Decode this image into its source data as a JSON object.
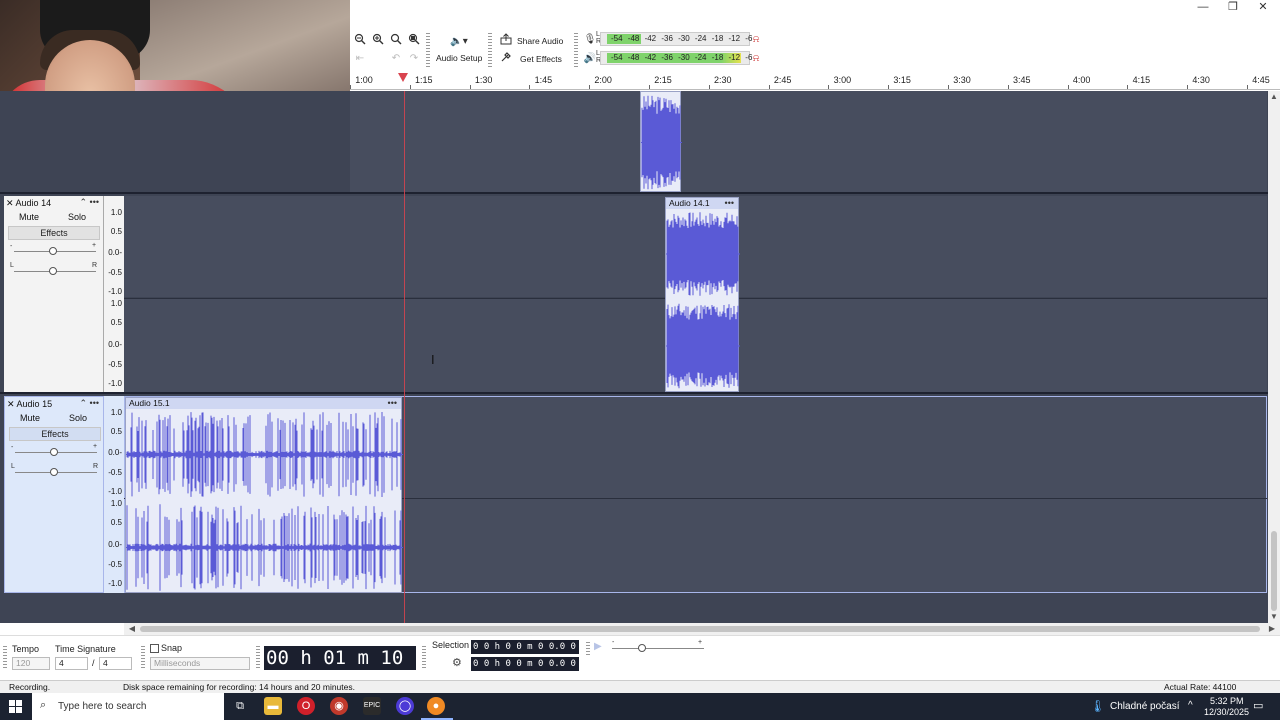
{
  "window": {
    "minimize_glyph": "—",
    "maximize_glyph": "❐",
    "close_glyph": "✕"
  },
  "toolbar": {
    "audio_setup_label": "Audio Setup",
    "share_audio_label": "Share Audio",
    "get_effects_label": "Get Effects",
    "meter_ticks": "-54 -48 -42 -36 -30 -24 -18 -12 -6",
    "meter_record_channels": "L R",
    "meter_play_channels": "L R",
    "icons": [
      "zoom-in-icon",
      "zoom-out-icon",
      "fit-selection-icon",
      "fit-project-icon",
      "zoom-toggle-icon",
      "trim-icon",
      "silence-icon",
      "undo-icon",
      "redo-icon",
      "speaker-icon",
      "microphone-icon",
      "share-icon",
      "effects-icon"
    ]
  },
  "ruler": {
    "labels": [
      "1:00",
      "1:15",
      "1:30",
      "1:45",
      "2:00",
      "2:15",
      "2:30",
      "2:45",
      "3:00",
      "3:15",
      "3:30",
      "3:45",
      "4:00",
      "4:15",
      "4:30",
      "4:45"
    ]
  },
  "tracks": [
    {
      "name": "Audio 14",
      "mute": "Mute",
      "solo": "Solo",
      "effects": "Effects",
      "gain_min": "-",
      "gain_max": "+",
      "pan_left": "L",
      "pan_right": "R",
      "scale": [
        "1.0",
        "0.5",
        "0.0-",
        "-0.5",
        "-1.0",
        "1.0",
        "0.5",
        "0.0-",
        "-0.5",
        "-1.0"
      ],
      "clip_name": "Audio 14.1"
    },
    {
      "name": "Audio 15",
      "mute": "Mute",
      "solo": "Solo",
      "effects": "Effects",
      "gain_min": "-",
      "gain_max": "+",
      "pan_left": "L",
      "pan_right": "R",
      "scale": [
        "1.0",
        "0.5",
        "0.0-",
        "-0.5",
        "-1.0",
        "1.0",
        "0.5",
        "0.0-",
        "-0.5",
        "-1.0"
      ],
      "clip_name": "Audio 15.1"
    }
  ],
  "clip_menu_glyph": "•••",
  "bottom": {
    "tempo_label": "Tempo",
    "tempo_value": "120",
    "time_signature_label": "Time Signature",
    "ts_numerator": "4",
    "ts_separator": "/",
    "ts_denominator": "4",
    "snap_label": "Snap",
    "snap_unit": "Milliseconds",
    "time_display": "00 h 01 m 10 s",
    "selection_label": "Selection",
    "selection_start": "0 0 h 0 0 m 0 0.0 0 0 s",
    "selection_end": "0 0 h 0 0 m 0 0.0 0 0 s",
    "playback_speed_min": "-",
    "playback_speed_max": "+"
  },
  "status": {
    "state": "Recording.",
    "disk_space": "Disk space remaining for recording: 14 hours and 20 minutes.",
    "actual_rate": "Actual Rate: 44100"
  },
  "taskbar": {
    "search_placeholder": "Type here to search",
    "weather": "Chladné počasí",
    "time": "5:32 PM",
    "date": "12/30/2025",
    "tray_chevron": "^"
  },
  "colors": {
    "waveform": "#5a5ad6",
    "track_background": "#474d5e",
    "playhead": "#d9444f",
    "meter_green": "#7fd36b",
    "meter_yellow": "#e6e14d"
  }
}
